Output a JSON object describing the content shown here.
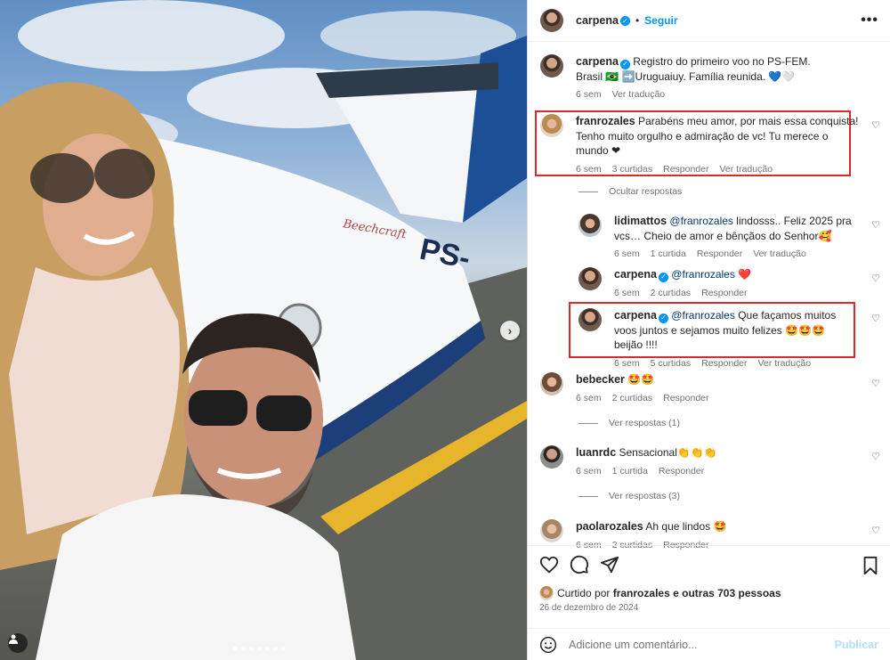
{
  "post": {
    "dots_count": 7,
    "active_dot": 0
  },
  "header": {
    "username": "carpena",
    "separator": "•",
    "follow_label": "Seguir",
    "more_label": "•••"
  },
  "caption": {
    "username": "carpena",
    "text_line1": "Registro do primeiro voo no PS-FEM.",
    "text_line2": "Brasil 🇧🇷 ➡️Uruguaiuy. Família reunida. 💙🤍",
    "time": "6 sem",
    "translate": "Ver tradução"
  },
  "comments": [
    {
      "username": "franrozales",
      "text": "Parabéns meu amor, por mais essa conquista! Tenho muito orgulho e admiração de vc! Tu merece o mundo ❤",
      "time": "6 sem",
      "likes": "3 curtidas",
      "reply": "Responder",
      "translate": "Ver tradução",
      "hide_replies": "Ocultar respostas",
      "replies": [
        {
          "username": "lidimattos",
          "mention": "@franrozales",
          "text": "lindosss.. Feliz 2025 pra vcs… Cheio de amor e bênçãos do Senhor🥰",
          "time": "6 sem",
          "likes": "1 curtida",
          "reply": "Responder",
          "translate": "Ver tradução"
        },
        {
          "username": "carpena",
          "mention": "@franrozales",
          "text": "❤️",
          "time": "6 sem",
          "likes": "2 curtidas",
          "reply": "Responder"
        },
        {
          "username": "carpena",
          "mention": "@franrozales",
          "text": "Que façamos muitos voos juntos e sejamos muito felizes 🤩🤩🤩 beijão !!!!",
          "time": "6 sem",
          "likes": "5 curtidas",
          "reply": "Responder",
          "translate": "Ver tradução"
        }
      ]
    },
    {
      "username": "bebecker",
      "text": "🤩🤩",
      "time": "6 sem",
      "likes": "2 curtidas",
      "reply": "Responder",
      "view_replies": "Ver respostas (1)"
    },
    {
      "username": "luanrdc",
      "text": "Sensacional👏👏👏",
      "time": "6 sem",
      "likes": "1 curtida",
      "reply": "Responder",
      "view_replies": "Ver respostas (3)"
    },
    {
      "username": "paolarozales",
      "text": "Ah que lindos 🤩",
      "time": "6 sem",
      "likes": "2 curtidas",
      "reply": "Responder"
    }
  ],
  "footer": {
    "liked_prefix": "Curtido por",
    "liked_user": "franrozales",
    "liked_mid": "e",
    "liked_others": "outras 703 pessoas",
    "date": "26 de dezembro de 2024",
    "comment_placeholder": "Adicione um comentário...",
    "publish_label": "Publicar"
  },
  "colors": {
    "accent": "#0095f6",
    "highlight_box": "#e0272c"
  },
  "icons": [
    "heart-icon",
    "comment-icon",
    "share-icon",
    "bookmark-icon",
    "emoji-icon",
    "tag-user-icon",
    "chevron-right-icon",
    "verified-icon",
    "more-icon"
  ]
}
